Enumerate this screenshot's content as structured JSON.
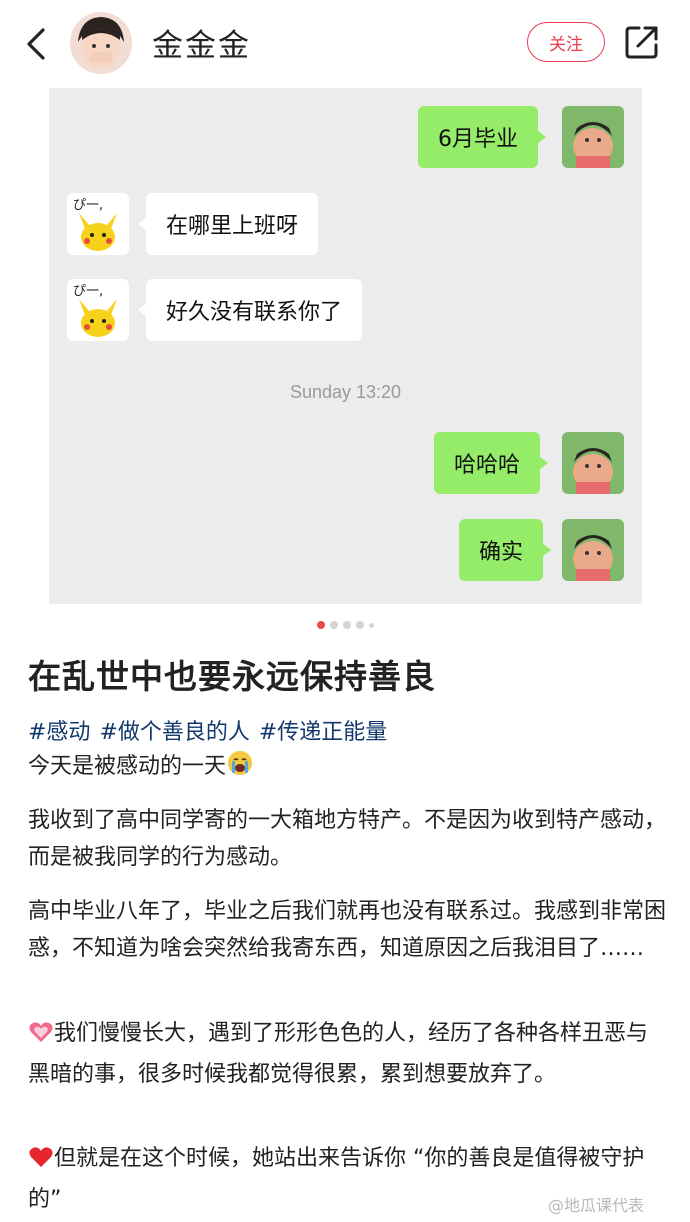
{
  "header": {
    "author_name": "金金金",
    "follow_label": "关注"
  },
  "chat": {
    "messages": [
      {
        "side": "right",
        "text": "6月毕业"
      },
      {
        "side": "left",
        "text": "在哪里上班呀"
      },
      {
        "side": "left",
        "text": "好久没有联系你了"
      },
      {
        "side": "right",
        "text": "哈哈哈"
      },
      {
        "side": "right",
        "text": "确实"
      }
    ],
    "time_label": "Sunday 13:20",
    "left_avatar_caption": "ぴ一,"
  },
  "pager": {
    "current": 1,
    "total": 5
  },
  "post": {
    "title": "在乱世中也要永远保持善良",
    "tags": [
      "#感动",
      "#做个善良的人",
      "#传递正能量"
    ],
    "intro": "今天是被感动的一天",
    "p1": "我收到了高中同学寄的一大箱地方特产。不是因为收到特产感动，而是被我同学的行为感动。",
    "p2": "高中毕业八年了，毕业之后我们就再也没有联系过。我感到非常困惑，不知道为啥会突然给我寄东西，知道原因之后我泪目了……",
    "p3": "我们慢慢长大，遇到了形形色色的人，经历了各种各样丑恶与黑暗的事，很多时候我都觉得很累，累到想要放弃了。",
    "p4": "但就是在这个时候，她站出来告诉你 “你的善良是值得被守护的”"
  },
  "watermark": "@地瓜课代表",
  "icons": {
    "back": "back-arrow-icon",
    "share": "share-icon",
    "cry": "crying-face-icon",
    "heart_pink": "sparkling-heart-icon",
    "heart_red": "red-heart-icon"
  },
  "colors": {
    "accent": "#ea3b4f",
    "tag": "#13386c",
    "bubble_green": "#95ec69",
    "chat_bg": "#ececec"
  }
}
